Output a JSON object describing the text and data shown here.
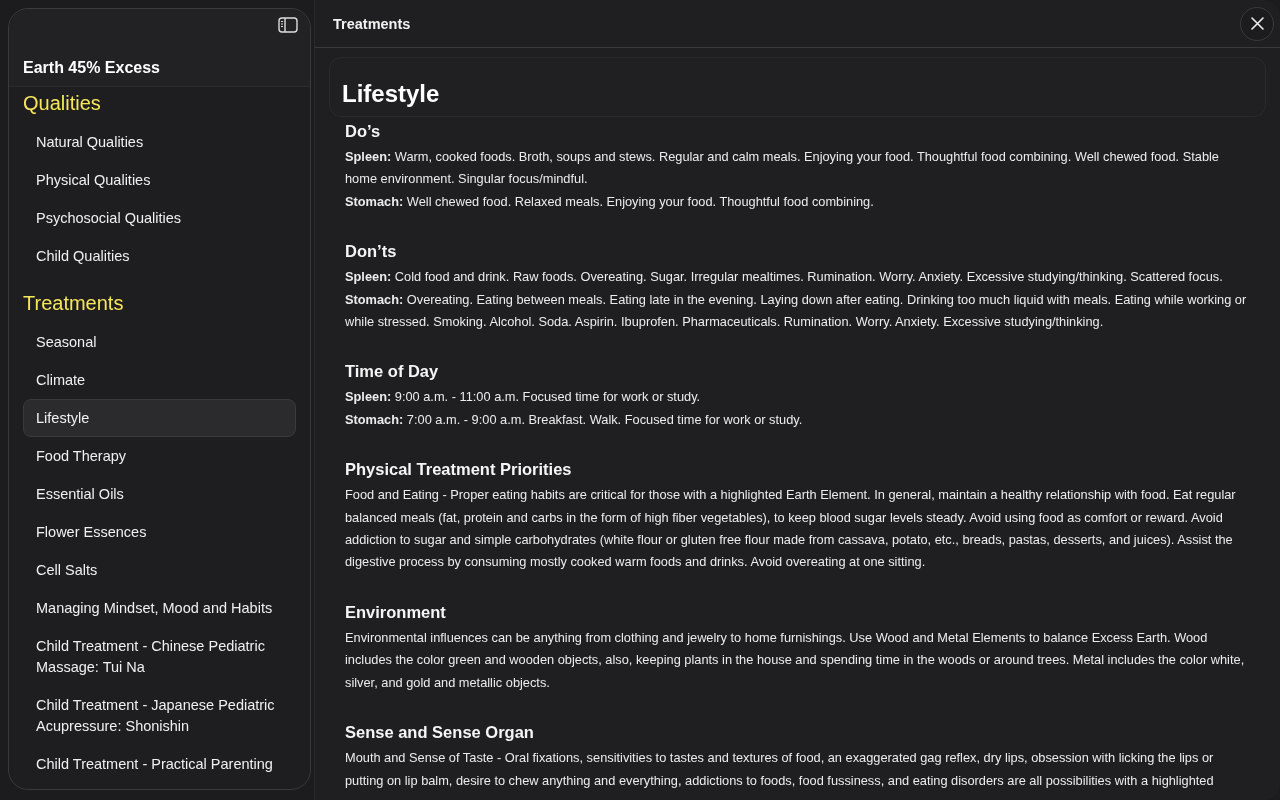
{
  "sidebar": {
    "title": "Earth 45% Excess",
    "groups": [
      {
        "title": "Qualities",
        "items": [
          {
            "label": "Natural Qualities",
            "selected": false
          },
          {
            "label": "Physical Qualities",
            "selected": false
          },
          {
            "label": "Psychosocial Qualities",
            "selected": false
          },
          {
            "label": "Child Qualities",
            "selected": false
          }
        ]
      },
      {
        "title": "Treatments",
        "items": [
          {
            "label": "Seasonal",
            "selected": false
          },
          {
            "label": "Climate",
            "selected": false
          },
          {
            "label": "Lifestyle",
            "selected": true
          },
          {
            "label": "Food Therapy",
            "selected": false
          },
          {
            "label": "Essential Oils",
            "selected": false
          },
          {
            "label": "Flower Essences",
            "selected": false
          },
          {
            "label": "Cell Salts",
            "selected": false
          },
          {
            "label": "Managing Mindset, Mood and Habits",
            "selected": false
          },
          {
            "label": "Child Treatment - Chinese Pediatric Massage: Tui Na",
            "selected": false
          },
          {
            "label": "Child Treatment - Japanese Pediatric Acupressure: Shonishin",
            "selected": false
          },
          {
            "label": "Child Treatment - Practical Parenting",
            "selected": false
          }
        ]
      }
    ]
  },
  "main": {
    "title": "Treatments",
    "heading": "Lifestyle",
    "sections": [
      {
        "heading": "Do’s",
        "paragraphs": [
          "**Spleen:** Warm, cooked foods. Broth, soups and stews. Regular and calm meals. Enjoying your food. Thoughtful food combining. Well chewed food. Stable home environment. Singular focus/mindful.",
          "**Stomach:** Well chewed food. Relaxed meals. Enjoying your food. Thoughtful food combining."
        ]
      },
      {
        "heading": "Don’ts",
        "paragraphs": [
          "**Spleen:** Cold food and drink. Raw foods. Overeating. Sugar. Irregular mealtimes. Rumination. Worry. Anxiety. Excessive studying/thinking. Scattered focus.",
          "**Stomach:** Overeating. Eating between meals. Eating late in the evening. Laying down after eating. Drinking too much liquid with meals. Eating while working or while stressed. Smoking. Alcohol. Soda. Aspirin. Ibuprofen. Pharmaceuticals. Rumination. Worry. Anxiety. Excessive studying/thinking."
        ]
      },
      {
        "heading": "Time of Day",
        "paragraphs": [
          "**Spleen:** 9:00 a.m. - 11:00 a.m. Focused time for work or study.",
          "**Stomach:** 7:00 a.m. - 9:00 a.m. Breakfast. Walk. Focused time for work or study."
        ]
      },
      {
        "heading": "Physical Treatment Priorities",
        "paragraphs": [
          "Food and Eating - Proper eating habits are critical for those with a highlighted Earth Element. In general, maintain a healthy relationship with food. Eat regular balanced meals (fat, protein and carbs in the form of high fiber vegetables), to keep blood sugar levels steady. Avoid using food as comfort or reward. Avoid addiction to sugar and simple carbohydrates (white flour or gluten free flour made from cassava, potato, etc., breads, pastas, desserts, and juices). Assist the digestive process by consuming mostly cooked warm foods and drinks. Avoid overeating at one sitting."
        ]
      },
      {
        "heading": "Environment",
        "paragraphs": [
          "Environmental influences can be anything from clothing and jewelry to home furnishings. Use Wood and Metal Elements to balance Excess Earth. Wood includes the color green and wooden objects, also, keeping plants in the house and spending time in the woods or around trees. Metal includes the color white, silver, and gold and metallic objects."
        ]
      },
      {
        "heading": "Sense and Sense Organ",
        "paragraphs": [
          "Mouth and Sense of Taste - Oral fixations, sensitivities to tastes and textures of food, an exaggerated gag reflex, dry lips, obsession with licking the lips or putting on lip balm, desire to chew anything and everything, addictions to foods, food fussiness, and eating disorders are all possibilities with a highlighted"
        ]
      }
    ]
  }
}
